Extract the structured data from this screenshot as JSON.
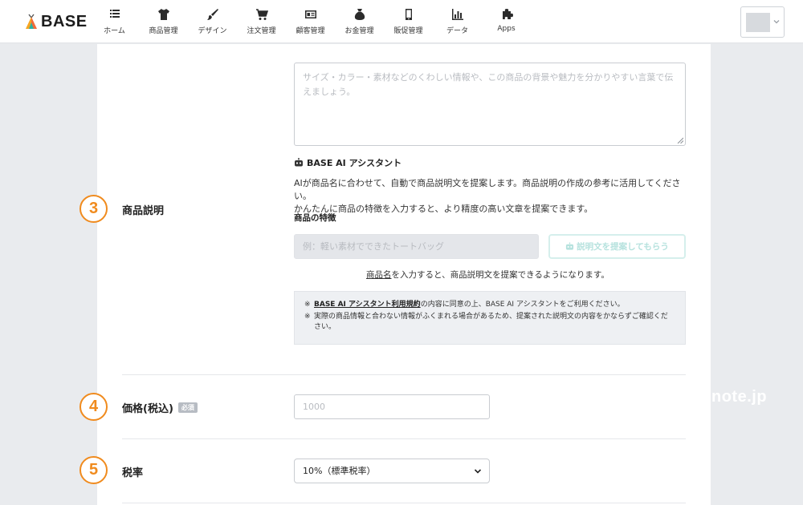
{
  "brand": {
    "name": "BASE"
  },
  "nav": [
    {
      "label": "ホーム",
      "icon": "home-list-icon"
    },
    {
      "label": "商品管理",
      "icon": "tshirt-icon"
    },
    {
      "label": "デザイン",
      "icon": "paintbrush-icon"
    },
    {
      "label": "注文管理",
      "icon": "cart-icon"
    },
    {
      "label": "顧客管理",
      "icon": "id-card-icon"
    },
    {
      "label": "お金管理",
      "icon": "money-bag-icon"
    },
    {
      "label": "販促管理",
      "icon": "smartphone-icon"
    },
    {
      "label": "データ",
      "icon": "bar-chart-icon"
    },
    {
      "label": "Apps",
      "icon": "puzzle-icon"
    }
  ],
  "description": {
    "step": "3",
    "label": "商品説明",
    "placeholder": "サイズ・カラー・素材などのくわしい情報や、この商品の背景や魅力を分かりやすい言葉で伝えましょう。"
  },
  "ai_assistant": {
    "title": "BASE AI アシスタント",
    "description_line1": "AIが商品名に合わせて、自動で商品説明文を提案します。商品説明の作成の参考に活用してください。",
    "description_line2": "かんたんに商品の特徴を入力すると、より精度の高い文章を提案できます。",
    "feature_label": "商品の特徴",
    "feature_placeholder": "例：軽い素材でできたトートバッグ",
    "suggest_button": "説明文を提案してもらう",
    "hint_link": "商品名",
    "hint_rest": "を入力すると、商品説明文を提案できるようになります。",
    "notice_mark": "※",
    "notice_terms_link": "BASE AI アシスタント利用規約",
    "notice_terms_rest": "の内容に同意の上、BASE AI アシスタントをご利用ください。",
    "notice_line2": "実際の商品情報と合わない情報がふくまれる場合があるため、提案された説明文の内容をかならずご確認ください。"
  },
  "price": {
    "step": "4",
    "label": "価格(税込)",
    "required_badge": "必須",
    "placeholder": "1000"
  },
  "tax": {
    "step": "5",
    "label": "税率",
    "selected": "10%（標準税率）"
  },
  "watermark": "note.jp",
  "colors": {
    "accent_orange": "#f08b1e",
    "disabled_teal": "#b6e2de",
    "background": "#e9ebee"
  }
}
